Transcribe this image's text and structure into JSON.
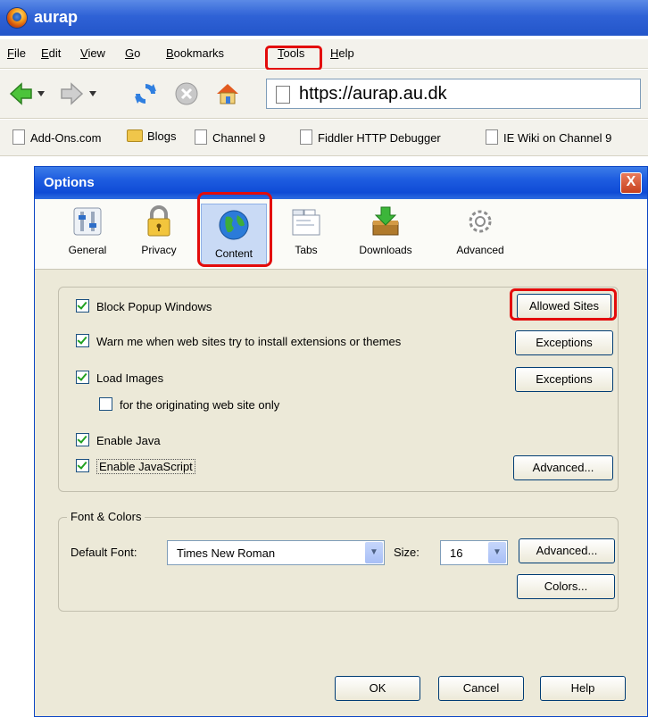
{
  "browser": {
    "title": "aurap",
    "menu": [
      "File",
      "Edit",
      "View",
      "Go",
      "Bookmarks",
      "Tools",
      "Help"
    ],
    "url": "https://aurap.au.dk",
    "bookmarks": [
      "Add-Ons.com",
      "Blogs",
      "Channel 9",
      "Fiddler HTTP Debugger",
      "IE Wiki on Channel 9"
    ]
  },
  "dialog": {
    "title": "Options",
    "close_label": "X",
    "panes": [
      "General",
      "Privacy",
      "Content",
      "Tabs",
      "Downloads",
      "Advanced"
    ],
    "selected_pane": "Content",
    "checks": {
      "block_popups": "Block Popup Windows",
      "warn_extensions": "Warn me when web sites try to install extensions or themes",
      "load_images": "Load Images",
      "originating_only": "for the originating web site only",
      "enable_java": "Enable Java",
      "enable_javascript": "Enable JavaScript"
    },
    "buttons": {
      "allowed_sites": "Allowed Sites",
      "exceptions1": "Exceptions",
      "exceptions2": "Exceptions",
      "js_advanced": "Advanced...",
      "font_advanced": "Advanced...",
      "colors": "Colors...",
      "ok": "OK",
      "cancel": "Cancel",
      "help": "Help"
    },
    "fonts": {
      "legend": "Font  & Colors",
      "default_font_label": "Default Font:",
      "default_font_value": "Times New Roman",
      "size_label": "Size:",
      "size_value": "16"
    }
  }
}
